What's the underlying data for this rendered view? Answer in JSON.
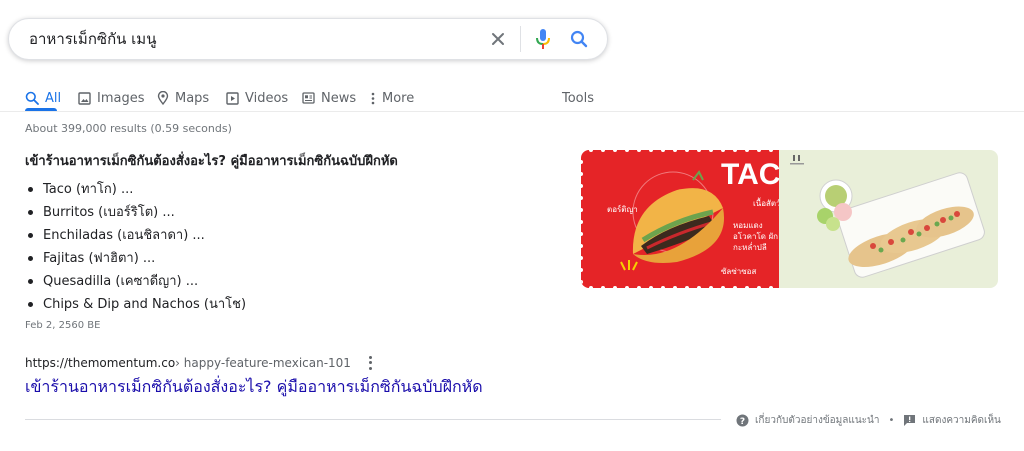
{
  "search": {
    "query": "อาหารเม็กซิกัน เมนู"
  },
  "tabs": [
    {
      "label": "All",
      "icon": "search-icon",
      "active": true
    },
    {
      "label": "Images",
      "icon": "image-icon"
    },
    {
      "label": "Maps",
      "icon": "map-pin-icon"
    },
    {
      "label": "Videos",
      "icon": "video-icon"
    },
    {
      "label": "News",
      "icon": "news-icon"
    },
    {
      "label": "More",
      "icon": "more-vertical-icon"
    }
  ],
  "tools_label": "Tools",
  "result_stats": "About 399,000 results (0.59 seconds)",
  "featured_snippet": {
    "title": "เข้าร้านอาหารเม็กซิกันต้องสั่งอะไร? คู่มืออาหารเม็กซิกันฉบับฝึกหัด",
    "items": [
      "Taco (ทาโก) ...",
      "Burritos (เบอร์ริโต) ...",
      "Enchiladas (เอนชิลาดา) ...",
      "Fajitas (ฟาฮิตา) ...",
      "Quesadilla (เคซาดีญา) ...",
      "Chips & Dip and Nachos (นาโช)"
    ],
    "date": "Feb 2, 2560 BE"
  },
  "result": {
    "domain": "https://themomentum.co",
    "breadcrumb": " › happy-feature-mexican-101",
    "title": "เข้าร้านอาหารเม็กซิกันต้องสั่งอะไร? คู่มืออาหารเม็กซิกันฉบับฝึกหัด"
  },
  "image_labels": {
    "heading": "TACOS",
    "tortilla": "ตอร์ติญา",
    "meat": "เนื้อสัตว์",
    "onion": "หอมแดง",
    "avocado": "อโวคาโด ผัก",
    "coriander": "กะหล่ำปลี",
    "salsa": "ซัลซ่าซอส"
  },
  "feedback": {
    "about_label": "เกี่ยวกับตัวอย่างข้อมูลแนะนำ",
    "feedback_label": "แสดงความคิดเห็น"
  },
  "colors": {
    "accent": "#1a73e8",
    "link": "#1a0dab",
    "image_red": "#e52427",
    "image_bg": "#e9efd9"
  }
}
